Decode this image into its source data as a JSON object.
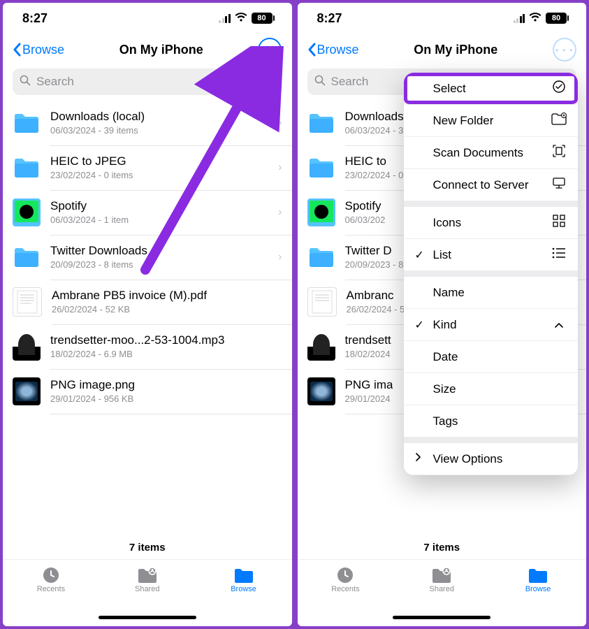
{
  "status": {
    "time": "8:27",
    "battery": "80"
  },
  "nav": {
    "back": "Browse",
    "title": "On My iPhone"
  },
  "search": {
    "placeholder": "Search"
  },
  "files": {
    "items": [
      {
        "name": "Downloads (local)",
        "meta": "06/03/2024 - 39 items",
        "kind": "folder"
      },
      {
        "name": "HEIC to JPEG",
        "meta": "23/02/2024 - 0 items",
        "kind": "folder"
      },
      {
        "name": "Spotify",
        "meta": "06/03/2024 - 1 item",
        "kind": "spotify"
      },
      {
        "name": "Twitter Downloads",
        "meta": "20/09/2023 - 8 items",
        "kind": "folder"
      },
      {
        "name": "Ambrane PB5 invoice (M).pdf",
        "meta": "26/02/2024 - 52 KB",
        "kind": "pdf"
      },
      {
        "name": "trendsetter-moo...2-53-1004.mp3",
        "meta": "18/02/2024 - 6.9 MB",
        "kind": "mp3"
      },
      {
        "name": "PNG image.png",
        "meta": "29/01/2024 - 956 KB",
        "kind": "png"
      }
    ],
    "truncated_names": {
      "1": "HEIC to",
      "2": "Spotify",
      "3": "Twitter D",
      "4": "Ambranc",
      "5": "trendsett",
      "6": "PNG ima"
    },
    "truncated_meta": {
      "2": "06/03/202",
      "5": "18/02/2024",
      "6": "29/01/2024"
    }
  },
  "menu": {
    "select": "Select",
    "new_folder": "New Folder",
    "scan": "Scan Documents",
    "connect": "Connect to Server",
    "icons": "Icons",
    "list": "List",
    "name": "Name",
    "kind": "Kind",
    "date": "Date",
    "size": "Size",
    "tags_": "Tags",
    "view_options": "View Options"
  },
  "footer": {
    "count": "7 items"
  },
  "tabs": {
    "recents": "Recents",
    "shared": "Shared",
    "browse": "Browse"
  }
}
